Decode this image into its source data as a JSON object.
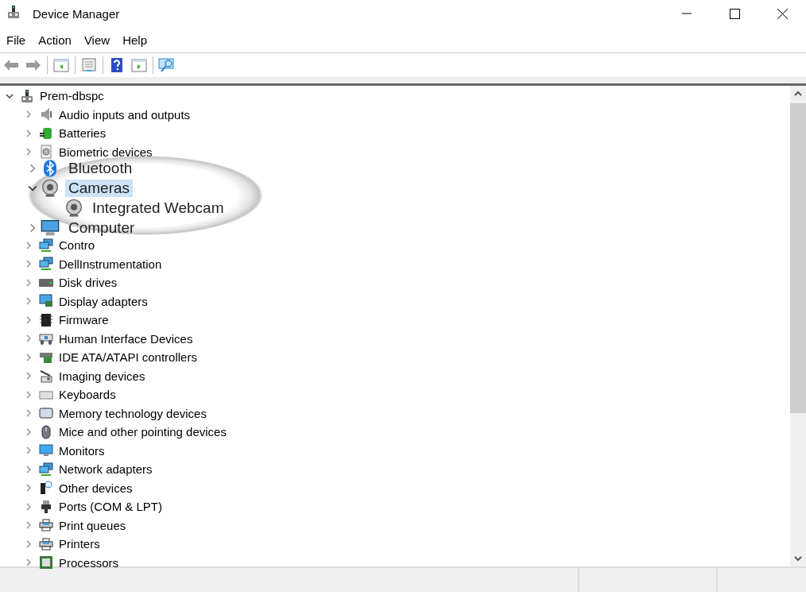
{
  "window": {
    "title": "Device Manager"
  },
  "menu": [
    "File",
    "Action",
    "View",
    "Help"
  ],
  "tree": {
    "label": "Prem-dbspc",
    "kind": "root",
    "expanded": true,
    "children_before": [
      {
        "label": "Audio inputs and outputs",
        "kind": "speaker",
        "expanded": false
      },
      {
        "label": "Batteries",
        "kind": "battery",
        "expanded": false
      },
      {
        "label": "Biometric devices",
        "kind": "fingerprint",
        "expanded": false
      }
    ],
    "magnifier": [
      {
        "label": "Bluetooth",
        "kind": "bluetooth",
        "expanded": false,
        "selected": false
      },
      {
        "label": "Cameras",
        "kind": "camera",
        "expanded": true,
        "selected": true,
        "children": [
          {
            "label": "Integrated Webcam",
            "kind": "camera",
            "selected": false
          }
        ]
      },
      {
        "label": "Computer",
        "kind": "computer",
        "expanded": false,
        "selected": false
      }
    ],
    "children_after": [
      {
        "label": "Contro",
        "kind": "network",
        "expanded": false
      },
      {
        "label": "DellInstrumentation",
        "kind": "network",
        "expanded": false
      },
      {
        "label": "Disk drives",
        "kind": "disk",
        "expanded": false
      },
      {
        "label": "Display adapters",
        "kind": "display",
        "expanded": false
      },
      {
        "label": "Firmware",
        "kind": "chip",
        "expanded": false
      },
      {
        "label": "Human Interface Devices",
        "kind": "hid",
        "expanded": false
      },
      {
        "label": "IDE ATA/ATAPI controllers",
        "kind": "ide",
        "expanded": false
      },
      {
        "label": "Imaging devices",
        "kind": "imaging",
        "expanded": false
      },
      {
        "label": "Keyboards",
        "kind": "keyboard",
        "expanded": false
      },
      {
        "label": "Memory technology devices",
        "kind": "memory",
        "expanded": false
      },
      {
        "label": "Mice and other pointing devices",
        "kind": "mouse",
        "expanded": false
      },
      {
        "label": "Monitors",
        "kind": "monitor",
        "expanded": false
      },
      {
        "label": "Network adapters",
        "kind": "network",
        "expanded": false
      },
      {
        "label": "Other devices",
        "kind": "other",
        "expanded": false
      },
      {
        "label": "Ports (COM & LPT)",
        "kind": "port",
        "expanded": false
      },
      {
        "label": "Print queues",
        "kind": "printer",
        "expanded": false
      },
      {
        "label": "Printers",
        "kind": "printer",
        "expanded": false
      },
      {
        "label": "Processors",
        "kind": "processor",
        "expanded": false
      }
    ]
  }
}
